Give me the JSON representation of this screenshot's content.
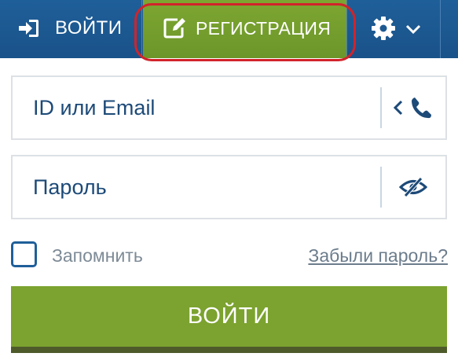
{
  "header": {
    "login_tab_label": "ВОЙТИ",
    "register_tab_label": "РЕГИСТРАЦИЯ",
    "login_icon": "sign-in-icon",
    "register_icon": "edit-icon",
    "settings_icon": "gear-icon",
    "settings_chevron": "chevron-down-icon"
  },
  "form": {
    "login_placeholder": "ID или Email",
    "password_placeholder": "Пароль",
    "login_icons": [
      "chevron-left-icon",
      "phone-icon"
    ],
    "password_icon": "eye-slash-icon",
    "remember_label": "Запомнить",
    "remember_checked": false,
    "forgot_link": "Забыли пароль?",
    "submit_label": "ВОЙТИ"
  },
  "colors": {
    "header_blue": "#1f5f99",
    "accent_green": "#7ca22f",
    "highlight_red": "#d2232a",
    "text_blue": "#1d4a78"
  }
}
